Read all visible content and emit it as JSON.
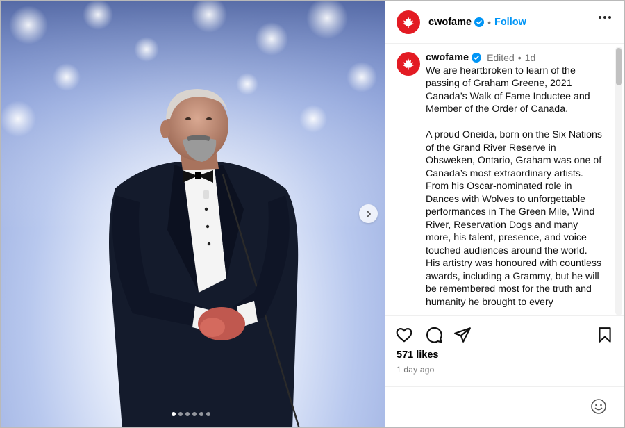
{
  "post": {
    "username": "cwofame",
    "follow_label": "Follow",
    "edited_label": "Edited",
    "time_short": "1d",
    "caption_paragraphs": [
      "We are heartbroken to learn of the passing of Graham Greene, 2021 Canada’s Walk of Fame Inductee and Member of the Order of Canada.",
      "A proud Oneida, born on the Six Nations of the Grand River Reserve in Ohsweken, Ontario, Graham was one of Canada’s most extraordinary artists. From his Oscar-nominated role in Dances with Wolves to unforgettable performances in The Green Mile, Wind River, Reservation Dogs and many more, his talent, presence, and voice touched audiences around the world. His artistry was honoured with countless awards, including a Grammy, but he will be remembered most for the truth and humanity he brought to every"
    ],
    "likes": "571 likes",
    "time_ago": "1 day ago"
  },
  "carousel": {
    "total": 6,
    "active_index": 0
  },
  "icons": {
    "header_more": "more-icon",
    "like": "heart-icon",
    "comment": "comment-icon",
    "share": "send-icon",
    "save": "bookmark-icon",
    "verified": "verified-badge-icon",
    "next": "chevron-right-icon",
    "emoji": "emoji-icon"
  },
  "colors": {
    "brand_red": "#e31b23",
    "link_blue": "#0095f6",
    "muted": "#737373"
  }
}
